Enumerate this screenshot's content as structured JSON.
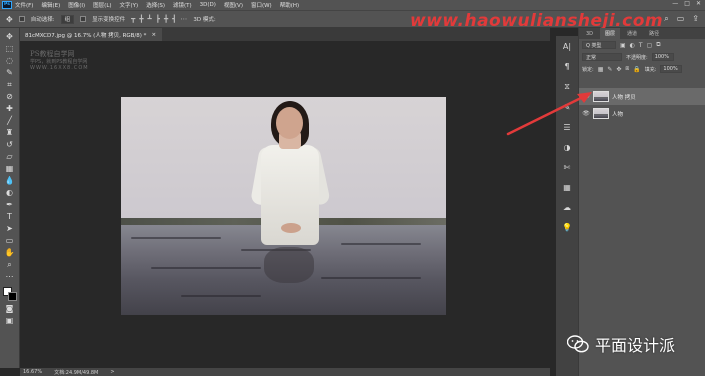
{
  "app": {
    "logo": "Ps"
  },
  "menu": {
    "items": [
      "文件(F)",
      "编辑(E)",
      "图像(I)",
      "图层(L)",
      "文字(Y)",
      "选择(S)",
      "滤镜(T)",
      "3D(D)",
      "视图(V)",
      "窗口(W)",
      "帮助(H)"
    ]
  },
  "window_controls": {
    "minimize": "—",
    "maximize": "□",
    "close": "✕"
  },
  "options_bar": {
    "auto_select_label": "自动选择:",
    "auto_select_value": "组",
    "show_transform_label": "显示变换控件",
    "mode_label": "3D 模式:"
  },
  "watermark": {
    "url": "www.haowuliansheji.com"
  },
  "document": {
    "tab_title": "81cMXCD7.jpg @ 16.7% (人物 拷贝, RGB/8) *",
    "tab_close": "×"
  },
  "tutorial_mark": {
    "line1": "PS教程自学网",
    "line2": "学PS，就到PS教程自学网",
    "line3": "WWW.16XX8.COM"
  },
  "status_bar": {
    "zoom": "16.67%",
    "doc_info": "文档:24.9M/49.8M",
    "arrow": ">"
  },
  "layers_panel": {
    "tabs": [
      "3D",
      "图层",
      "通道",
      "路径"
    ],
    "active_tab_index": 1,
    "kind_label": "Q 类型",
    "blend_mode": "正常",
    "opacity_label": "不透明度:",
    "opacity_value": "100%",
    "lock_label": "锁定:",
    "fill_label": "填充:",
    "fill_value": "100%",
    "layers": [
      {
        "name": "人物 拷贝",
        "selected": true,
        "visible": true
      },
      {
        "name": "人物",
        "selected": false,
        "visible": true
      }
    ]
  },
  "icons": {
    "eye": "eye-icon",
    "annotation": "red-arrow-icon",
    "wechat": "wechat-icon"
  },
  "colors": {
    "accent_red": "#e23a3a",
    "ps_blue": "#31a8ff",
    "panel_bg": "#535353",
    "canvas_bg": "#282828"
  },
  "wechat_badge": {
    "text": "平面设计派"
  }
}
